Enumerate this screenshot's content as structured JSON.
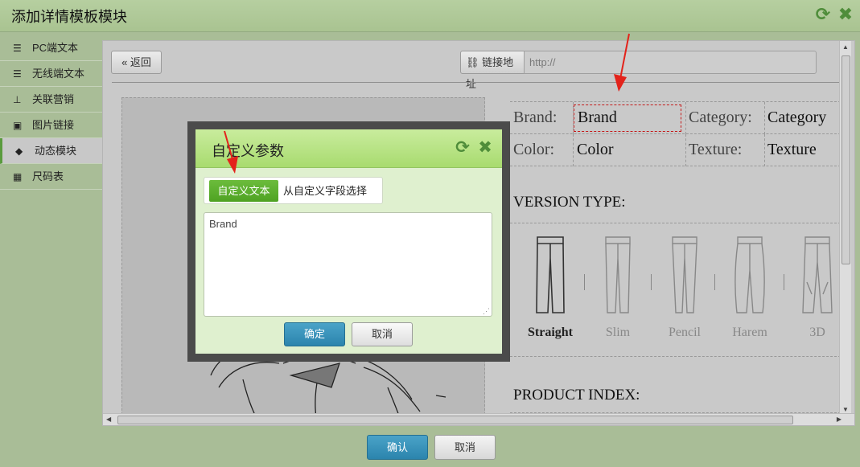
{
  "window": {
    "title": "添加详情模板模块",
    "refresh_icon": "refresh-icon",
    "close_icon": "close-icon"
  },
  "sidebar": {
    "items": [
      {
        "label": "PC端文本",
        "icon": "align-left-icon",
        "active": false
      },
      {
        "label": "无线端文本",
        "icon": "align-left-icon",
        "active": false
      },
      {
        "label": "关联营销",
        "icon": "sitemap-icon",
        "active": false
      },
      {
        "label": "图片链接",
        "icon": "picture-icon",
        "active": false
      },
      {
        "label": "动态模块",
        "icon": "tag-icon",
        "active": true
      },
      {
        "label": "尺码表",
        "icon": "table-icon",
        "active": false
      }
    ]
  },
  "toolbar": {
    "back_label": "« 返回",
    "link_label": "链接地址",
    "link_value": "http://"
  },
  "attributes": {
    "rows": [
      {
        "label1": "Brand:",
        "value1": "Brand",
        "label2": "Category:",
        "value2": "Category"
      },
      {
        "label1": "Color:",
        "value1": "Color",
        "label2": "Texture:",
        "value2": "Texture"
      }
    ]
  },
  "version_type": {
    "heading": "VERSION TYPE:",
    "options": [
      "Straight",
      "Slim",
      "Pencil",
      "Harem",
      "3D"
    ]
  },
  "product_index": {
    "heading": "PRODUCT INDEX:"
  },
  "footer": {
    "confirm_label": "确认",
    "cancel_label": "取消"
  },
  "modal": {
    "title": "自定义参数",
    "tabs": [
      "自定义文本",
      "从自定义字段选择"
    ],
    "text_value": "Brand",
    "ok_label": "确定",
    "cancel_label": "取消"
  },
  "colors": {
    "accent_green": "#5a9b3e",
    "primary_blue": "#2b84ad",
    "annotation_red": "#e3231b"
  }
}
